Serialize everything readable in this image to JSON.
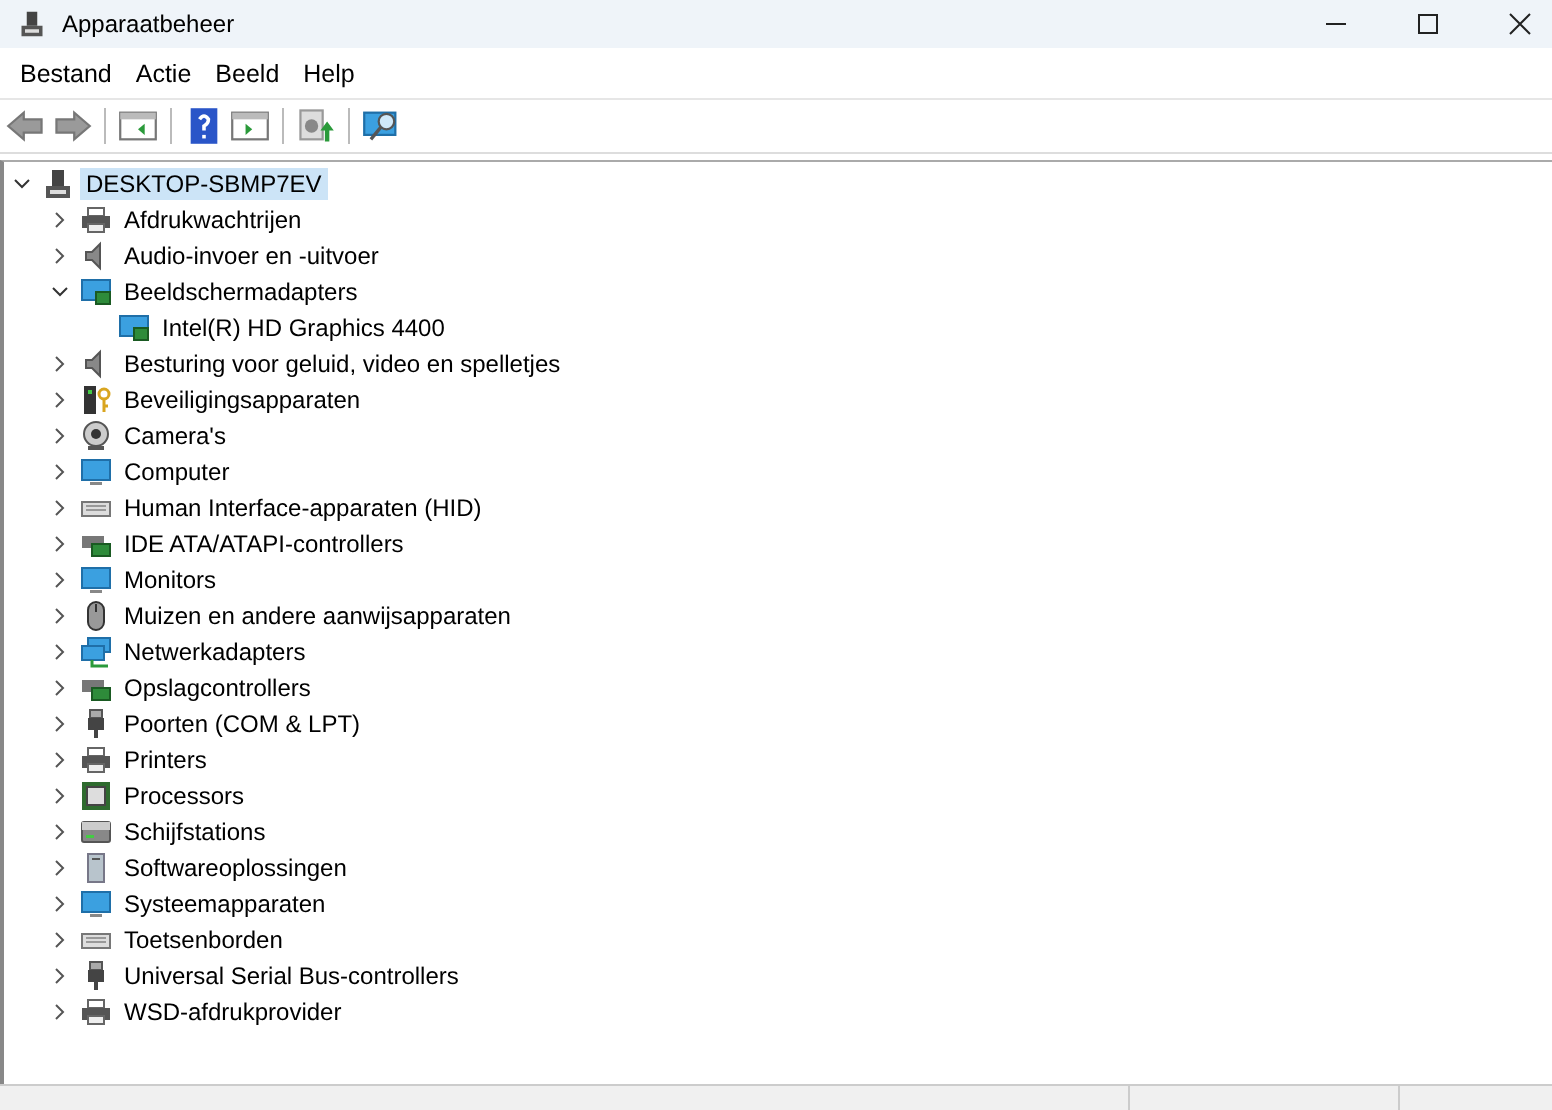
{
  "window": {
    "title": "Apparaatbeheer"
  },
  "menu": [
    "Bestand",
    "Actie",
    "Beeld",
    "Help"
  ],
  "tree": {
    "label": "DESKTOP-SBMP7EV",
    "expanded": true,
    "selected": true,
    "children": [
      {
        "label": "Afdrukwachtrijen",
        "expanded": false,
        "selected": false
      },
      {
        "label": "Audio-invoer en -uitvoer",
        "expanded": false,
        "selected": false
      },
      {
        "label": "Beeldschermadapters",
        "expanded": true,
        "selected": false,
        "children": [
          {
            "label": "Intel(R) HD Graphics 4400",
            "selected": false
          }
        ]
      },
      {
        "label": "Besturing voor geluid, video en spelletjes",
        "expanded": false,
        "selected": false
      },
      {
        "label": "Beveiligingsapparaten",
        "expanded": false,
        "selected": false
      },
      {
        "label": "Camera's",
        "expanded": false,
        "selected": false
      },
      {
        "label": "Computer",
        "expanded": false,
        "selected": false
      },
      {
        "label": "Human Interface-apparaten (HID)",
        "expanded": false,
        "selected": false
      },
      {
        "label": "IDE ATA/ATAPI-controllers",
        "expanded": false,
        "selected": false
      },
      {
        "label": "Monitors",
        "expanded": false,
        "selected": false
      },
      {
        "label": "Muizen en andere aanwijsapparaten",
        "expanded": false,
        "selected": false
      },
      {
        "label": "Netwerkadapters",
        "expanded": false,
        "selected": false
      },
      {
        "label": "Opslagcontrollers",
        "expanded": false,
        "selected": false
      },
      {
        "label": "Poorten (COM & LPT)",
        "expanded": false,
        "selected": false
      },
      {
        "label": "Printers",
        "expanded": false,
        "selected": false
      },
      {
        "label": "Processors",
        "expanded": false,
        "selected": false
      },
      {
        "label": "Schijfstations",
        "expanded": false,
        "selected": false
      },
      {
        "label": "Softwareoplossingen",
        "expanded": false,
        "selected": false
      },
      {
        "label": "Systeemapparaten",
        "expanded": false,
        "selected": false
      },
      {
        "label": "Toetsenborden",
        "expanded": false,
        "selected": false
      },
      {
        "label": "Universal Serial Bus-controllers",
        "expanded": false,
        "selected": false
      },
      {
        "label": "WSD-afdrukprovider",
        "expanded": false,
        "selected": false
      }
    ]
  }
}
